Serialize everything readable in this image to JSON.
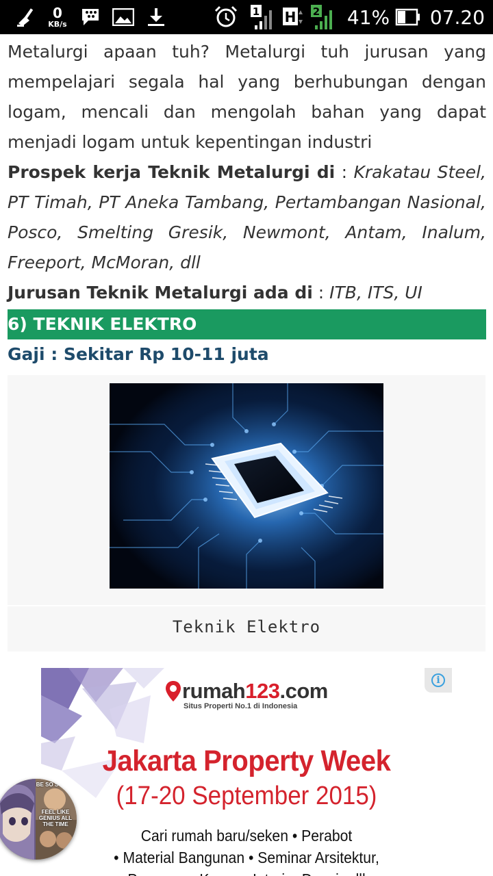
{
  "status_bar": {
    "icons": [
      "broom-cleaner-icon",
      "data-speed-indicator",
      "bbm-icon",
      "image-notification-icon",
      "download-icon",
      "alarm-icon",
      "signal-sim1-icon",
      "hspa-icon",
      "signal-sim2-icon",
      "battery-icon"
    ],
    "speed_value": "0",
    "speed_unit": "KB/s",
    "sim1_label": "1",
    "network_type": "H",
    "sim2_label": "2",
    "battery_percent": "41%",
    "battery_level": 0.41,
    "time": "07.20"
  },
  "article": {
    "intro": "Metalurgi apaan tuh? Metalurgi tuh jurusan yang mempelajari segala hal yang berhubungan dengan logam, mencali dan mengolah bahan yang dapat menjadi logam untuk kepentingan industri",
    "prospects_label": "Prospek kerja Teknik Metalurgi di",
    "prospects_sep": " : ",
    "prospects_value": "Krakatau Steel, PT Timah, PT Aneka Tambang, Pertambangan Nasional, Posco, Smelting Gresik, Newmont, Antam, Inalum, Freeport, McMoran, dll",
    "campus_label": "Jurusan Teknik Metalurgi ada di",
    "campus_sep": " : ",
    "campus_value": "ITB, ITS, UI",
    "section_title": "6) TEKNIK ELEKTRO",
    "salary": "Gaji : Sekitar Rp 10-11 juta",
    "figure_caption": "Teknik Elektro"
  },
  "ad": {
    "brand_prefix": "rumah",
    "brand_accent": "123",
    "brand_suffix": ".com",
    "tagline": "Situs Properti No.1 di Indonesia",
    "title": "Jakarta Property Week",
    "dates": "(17-20 September 2015)",
    "line1": "Cari rumah baru/seken • Perabot",
    "line2": "• Material Bangunan • Seminar Arsitektur,",
    "line3": "Pameran • Konsep Interior Desain dll",
    "info_icon": "i"
  },
  "chat_head": {
    "meme_top": "BE SO STUPID",
    "meme_mid": "FEEL LIKE GENIUS ALL THE TIME"
  },
  "colors": {
    "section_bg": "#1a9a60",
    "salary_text": "#1e4b6b",
    "ad_red": "#d4232d",
    "info_blue": "#3aa0de"
  }
}
